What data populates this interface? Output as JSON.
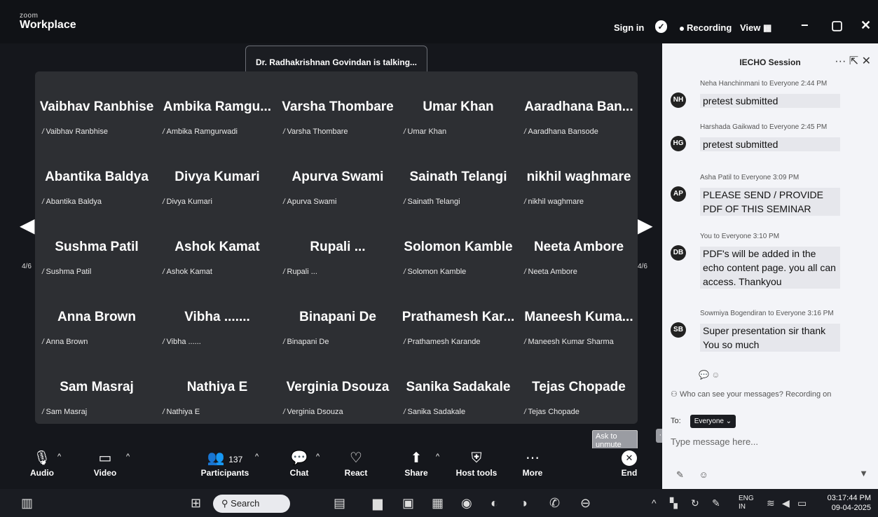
{
  "app": {
    "brand_small": "zoom",
    "brand_large": "Workplace"
  },
  "titlebar": {
    "sign_in": "Sign in",
    "recording": "Recording",
    "view": "View",
    "view_icon": "grid-icon"
  },
  "talking_banner": "Dr. Radhakrishnan Govindan is talking...",
  "gallery": {
    "tiles": [
      {
        "name_large": "Vaibhav Ranbhise",
        "name_small": "Vaibhav Ranbhise"
      },
      {
        "name_large": "Ambika  Ramgu...",
        "name_small": "Ambika Ramgurwadi"
      },
      {
        "name_large": "Varsha Thombare",
        "name_small": "Varsha Thombare"
      },
      {
        "name_large": "Umar Khan",
        "name_small": "Umar Khan"
      },
      {
        "name_large": "Aaradhana  Ban...",
        "name_small": "Aaradhana Bansode"
      },
      {
        "name_large": "Abantika Baldya",
        "name_small": "Abantika Baldya"
      },
      {
        "name_large": "Divya Kumari",
        "name_small": "Divya Kumari"
      },
      {
        "name_large": "Apurva Swami",
        "name_small": "Apurva Swami"
      },
      {
        "name_large": "Sainath Telangi",
        "name_small": "Sainath Telangi"
      },
      {
        "name_large": "nikhil waghmare",
        "name_small": "nikhil waghmare"
      },
      {
        "name_large": "Sushma Patil",
        "name_small": "Sushma Patil"
      },
      {
        "name_large": "Ashok Kamat",
        "name_small": "Ashok Kamat"
      },
      {
        "name_large": "Rupali ...",
        "name_small": "Rupali ..."
      },
      {
        "name_large": "Solomon Kamble",
        "name_small": "Solomon Kamble"
      },
      {
        "name_large": "Neeta Ambore",
        "name_small": "Neeta Ambore"
      },
      {
        "name_large": "Anna Brown",
        "name_small": "Anna Brown"
      },
      {
        "name_large": "Vibha .......",
        "name_small": "Vibha ......"
      },
      {
        "name_large": "Binapani De",
        "name_small": "Binapani De"
      },
      {
        "name_large": "Prathamesh  Kar...",
        "name_small": "Prathamesh Karande"
      },
      {
        "name_large": "Maneesh  Kuma...",
        "name_small": "Maneesh Kumar Sharma"
      },
      {
        "name_large": "Sam Masraj",
        "name_small": "Sam Masraj"
      },
      {
        "name_large": "Nathiya E",
        "name_small": "Nathiya E"
      },
      {
        "name_large": "Verginia Dsouza",
        "name_small": "Verginia Dsouza"
      },
      {
        "name_large": "Sanika Sadakale",
        "name_small": "Sanika Sadakale"
      },
      {
        "name_large": "Tejas Chopade",
        "name_small": "Tejas Chopade"
      }
    ],
    "page_left": "4/6",
    "page_right": "4/6",
    "ask_to_unmute": "Ask to unmute"
  },
  "toolbar": {
    "audio": "Audio",
    "video": "Video",
    "participants": "Participants",
    "participants_count": "137",
    "chat": "Chat",
    "react": "React",
    "share": "Share",
    "host_tools": "Host tools",
    "more": "More",
    "end": "End"
  },
  "chat": {
    "title": "IECHO Session",
    "messages": [
      {
        "initials": "NH",
        "meta": "Neha Hanchinmani to Everyone 2:44 PM",
        "text": "pretest submitted"
      },
      {
        "initials": "HG",
        "meta": "Harshada Gaikwad to Everyone 2:45 PM",
        "text": "pretest submitted"
      },
      {
        "initials": "AP",
        "meta": "Asha Patil to Everyone 3:09 PM",
        "text": "PLEASE SEND / PROVIDE PDF OF THIS SEMINAR"
      },
      {
        "initials": "DB",
        "meta": "You to Everyone 3:10 PM",
        "text": "PDF's will be added in the echo content page. you all can access. Thankyou"
      },
      {
        "initials": "SB",
        "meta": "Sowmiya Bogendiran to Everyone 3:16 PM",
        "text": "Super presentation sir thank You so much"
      }
    ],
    "who_can_see": "Who can see your messages? Recording on",
    "to_label": "To:",
    "to_value": "Everyone",
    "placeholder": "Type message here..."
  },
  "taskbar": {
    "search": "Search",
    "lang_top": "ENG",
    "lang_bottom": "IN",
    "time": "03:17:44 PM",
    "date": "09-04-2025"
  }
}
